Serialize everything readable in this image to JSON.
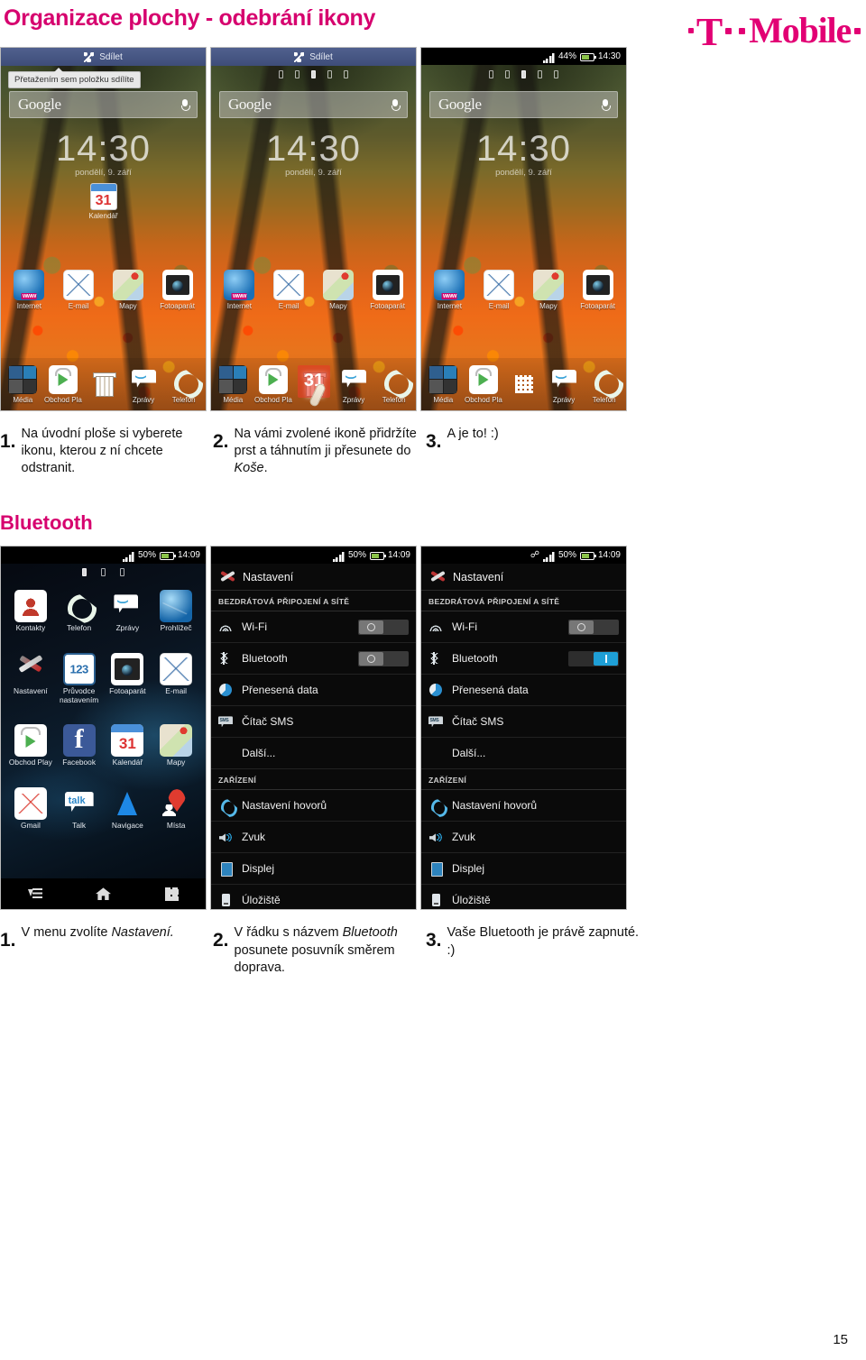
{
  "document": {
    "title": "Organizace plochy - odebrání ikony",
    "page_number": "15",
    "brand": "T··Mobile·",
    "accent_color": "#e20074"
  },
  "section_bluetooth": {
    "heading": "Bluetooth"
  },
  "homescreen": {
    "share_label": "Sdílet",
    "tooltip": "Přetažením sem položku sdílíte",
    "google_label": "Google",
    "clock": "14:30",
    "date": "pondělí, 9. září",
    "calendar_widget": {
      "label": "Kalendář",
      "day": "31"
    },
    "status": {
      "battery": "44%",
      "time": "14:30"
    },
    "apps_row1": [
      {
        "label": "Internet",
        "icon": "internet-icon"
      },
      {
        "label": "E-mail",
        "icon": "email-icon"
      },
      {
        "label": "Mapy",
        "icon": "maps-icon"
      },
      {
        "label": "Fotoaparát",
        "icon": "camera-icon"
      }
    ],
    "dock": [
      {
        "label": "Média",
        "icon": "media-icon"
      },
      {
        "label": "Obchod Pla",
        "icon": "play-store-icon"
      },
      {
        "label": "",
        "icon": "trash-icon"
      },
      {
        "label": "Zprávy",
        "icon": "messages-icon"
      },
      {
        "label": "Telefon",
        "icon": "phone-icon"
      }
    ],
    "dock_removed_center": {
      "label": "",
      "icon": "app-drawer-grid-icon"
    },
    "drag_item": {
      "label": "Kalendář",
      "day": "31"
    }
  },
  "steps_remove_icon": [
    {
      "num": "1.",
      "text": "Na úvodní ploše si vyberete ikonu, kterou z ní chcete odstranit."
    },
    {
      "num": "2.",
      "text": "Na vámi zvolené ikoně přidržíte prst a táhnutím ji přesunete do ",
      "em": "Koše",
      "tail": "."
    },
    {
      "num": "3.",
      "text": "A je to!  :)"
    }
  ],
  "app_drawer": {
    "status": {
      "battery": "50%",
      "time": "14:09"
    },
    "apps": [
      {
        "label": "Kontakty",
        "icon": "contacts-icon"
      },
      {
        "label": "Telefon",
        "icon": "phone-icon"
      },
      {
        "label": "Zprávy",
        "icon": "messages-icon"
      },
      {
        "label": "Prohlížeč",
        "icon": "browser-icon"
      },
      {
        "label": "Nastavení",
        "icon": "settings-icon"
      },
      {
        "label": "Průvodce nastavením",
        "icon": "setup-wizard-icon"
      },
      {
        "label": "Fotoaparát",
        "icon": "camera-icon"
      },
      {
        "label": "E-mail",
        "icon": "email-icon"
      },
      {
        "label": "Obchod Play",
        "icon": "play-store-icon"
      },
      {
        "label": "Facebook",
        "icon": "facebook-icon"
      },
      {
        "label": "Kalendář",
        "icon": "calendar-icon"
      },
      {
        "label": "Mapy",
        "icon": "maps-icon"
      },
      {
        "label": "Gmail",
        "icon": "gmail-icon"
      },
      {
        "label": "Talk",
        "icon": "talk-icon"
      },
      {
        "label": "Navigace",
        "icon": "navigation-icon"
      },
      {
        "label": "Místa",
        "icon": "places-icon"
      }
    ],
    "nav": [
      {
        "icon": "recent-apps-icon"
      },
      {
        "icon": "home-icon"
      },
      {
        "icon": "app-drawer-grid-icon"
      }
    ]
  },
  "settings_screen": {
    "title": "Nastavení",
    "status_off": {
      "battery": "50%",
      "time": "14:09"
    },
    "status_on": {
      "battery": "50%",
      "time": "14:09",
      "bluetooth_indicator": "bluetooth-icon"
    },
    "group_wireless": "BEZDRÁTOVÁ PŘIPOJENÍ A SÍTĚ",
    "group_device": "ZAŘÍZENÍ",
    "rows_wireless": [
      {
        "label": "Wi-Fi",
        "icon": "wifi-icon",
        "toggle": "off"
      },
      {
        "label": "Bluetooth",
        "icon": "bluetooth-icon",
        "toggle": "off"
      },
      {
        "label": "Přenesená data",
        "icon": "data-usage-icon",
        "toggle": "none"
      },
      {
        "label": "Čítač SMS",
        "icon": "sms-counter-icon",
        "toggle": "none"
      },
      {
        "label": "Další...",
        "icon": "none",
        "toggle": "none"
      }
    ],
    "rows_wireless_on": [
      {
        "label": "Wi-Fi",
        "icon": "wifi-icon",
        "toggle": "off"
      },
      {
        "label": "Bluetooth",
        "icon": "bluetooth-icon",
        "toggle": "on"
      },
      {
        "label": "Přenesená data",
        "icon": "data-usage-icon",
        "toggle": "none"
      },
      {
        "label": "Čítač SMS",
        "icon": "sms-counter-icon",
        "toggle": "none"
      },
      {
        "label": "Další...",
        "icon": "none",
        "toggle": "none"
      }
    ],
    "rows_device": [
      {
        "label": "Nastavení hovorů",
        "icon": "call-settings-icon"
      },
      {
        "label": "Zvuk",
        "icon": "sound-icon"
      },
      {
        "label": "Displej",
        "icon": "display-icon"
      },
      {
        "label": "Úložiště",
        "icon": "storage-icon"
      }
    ]
  },
  "steps_bluetooth": [
    {
      "num": "1.",
      "text": "V menu zvolíte ",
      "em": "Nastavení.",
      "tail": ""
    },
    {
      "num": "2.",
      "text": "V řádku s názvem ",
      "em": "Bluetooth",
      "tail": "  posunete posuvník směrem doprava."
    },
    {
      "num": "3.",
      "text": "Vaše Bluetooth je právě zapnuté.  :)"
    }
  ]
}
